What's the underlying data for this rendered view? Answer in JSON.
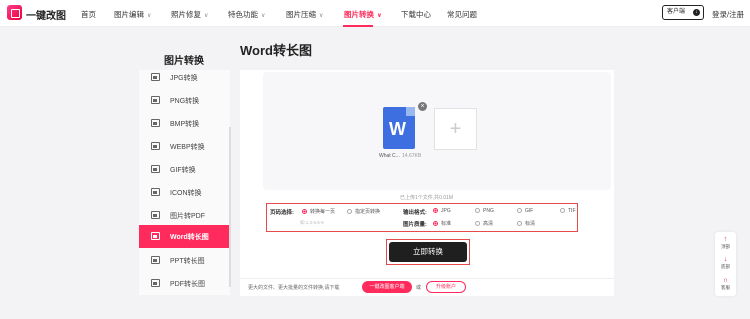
{
  "header": {
    "logo_text": "一键改图",
    "nav": [
      {
        "label": "首页",
        "dropdown": false
      },
      {
        "label": "图片编辑",
        "dropdown": true
      },
      {
        "label": "照片修复",
        "dropdown": true
      },
      {
        "label": "特色功能",
        "dropdown": true
      },
      {
        "label": "图片压缩",
        "dropdown": true
      },
      {
        "label": "图片转换",
        "dropdown": true,
        "active": true
      },
      {
        "label": "下载中心",
        "dropdown": false
      },
      {
        "label": "常见问题",
        "dropdown": false
      }
    ],
    "client_button": "客户端",
    "login": "登录/注册",
    "accent_color": "#ff2b5c"
  },
  "sidebar": {
    "title": "图片转换",
    "items": [
      {
        "label": "JPG转换"
      },
      {
        "label": "PNG转换"
      },
      {
        "label": "BMP转换"
      },
      {
        "label": "WEBP转换"
      },
      {
        "label": "GIF转换"
      },
      {
        "label": "ICON转换"
      },
      {
        "label": "图片转PDF"
      },
      {
        "label": "Word转长图",
        "active": true
      },
      {
        "label": "PPT转长图"
      },
      {
        "label": "PDF转长图"
      }
    ]
  },
  "main": {
    "title": "Word转长图",
    "file": {
      "icon_letter": "W",
      "name": "What C...",
      "size": "14.67KB"
    },
    "upload_info": "已上传1个文件,共0.01M",
    "options": {
      "page_label": "页码选择:",
      "page_options": [
        "转换每一页",
        "指定页转换"
      ],
      "page_placeholder": "如:1,3-5,5-9",
      "format_label": "输出格式:",
      "format_options": [
        "JPG",
        "PNG",
        "GIF",
        "TIF"
      ],
      "quality_label": "图片质量:",
      "quality_options": [
        "标准",
        "高清",
        "标清"
      ]
    },
    "convert_button": "立即转换",
    "bottom": {
      "text": "更大的文件、更大批量的文件转换,请下载",
      "vip_button": "一键改图客户端",
      "or": "或",
      "upgrade_button": "升级账户"
    }
  },
  "float": {
    "items": [
      {
        "icon": "arrow-up-icon",
        "label": "顶部"
      },
      {
        "icon": "arrow-down-icon",
        "label": "底部"
      },
      {
        "icon": "headset-icon",
        "label": "客服"
      }
    ]
  }
}
